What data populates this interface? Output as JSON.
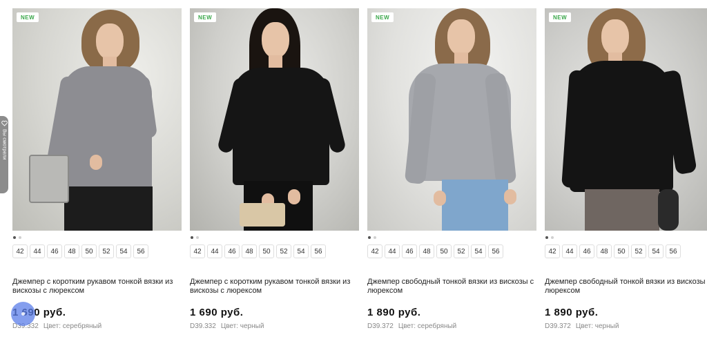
{
  "side_tab": {
    "label": "Вы смотрели",
    "icon": "heart-icon"
  },
  "products": [
    {
      "badge": "NEW",
      "sizes": [
        "42",
        "44",
        "46",
        "48",
        "50",
        "52",
        "54",
        "56"
      ],
      "title": "Джемпер с коротким рукавом тонкой вязки из вискозы с люрексом",
      "price": "1 690 руб.",
      "sku": "D39.332",
      "color_label": "Цвет: серебряный",
      "image_colors": {
        "top": "#8d8d92",
        "bottom": "#1c1c1c",
        "hair": "#8a6a48"
      }
    },
    {
      "badge": "NEW",
      "sizes": [
        "42",
        "44",
        "46",
        "48",
        "50",
        "52",
        "54",
        "56"
      ],
      "title": "Джемпер с коротким рукавом тонкой вязки из вискозы с люрексом",
      "price": "1 690 руб.",
      "sku": "D39.332",
      "color_label": "Цвет: черный",
      "image_colors": {
        "top": "#151515",
        "bottom": "#101010",
        "hair": "#1a1410"
      }
    },
    {
      "badge": "NEW",
      "sizes": [
        "42",
        "44",
        "46",
        "48",
        "50",
        "52",
        "54",
        "56"
      ],
      "title": "Джемпер свободный тонкой вязки из вискозы с люрексом",
      "price": "1 890 руб.",
      "sku": "D39.372",
      "color_label": "Цвет: серебряный",
      "image_colors": {
        "top": "#a6a8ad",
        "bottom": "#7fa6cc",
        "hair": "#8a6a4a"
      }
    },
    {
      "badge": "NEW",
      "sizes": [
        "42",
        "44",
        "46",
        "48",
        "50",
        "52",
        "54",
        "56"
      ],
      "title": "Джемпер свободный тонкой вязки из вискозы с люрексом",
      "price": "1 890 руб.",
      "sku": "D39.372",
      "color_label": "Цвет: черный",
      "image_colors": {
        "top": "#141414",
        "bottom": "#6f6661",
        "hair": "#8d6b49"
      }
    }
  ],
  "scroll_button_icon": "scroll-indicator-icon"
}
